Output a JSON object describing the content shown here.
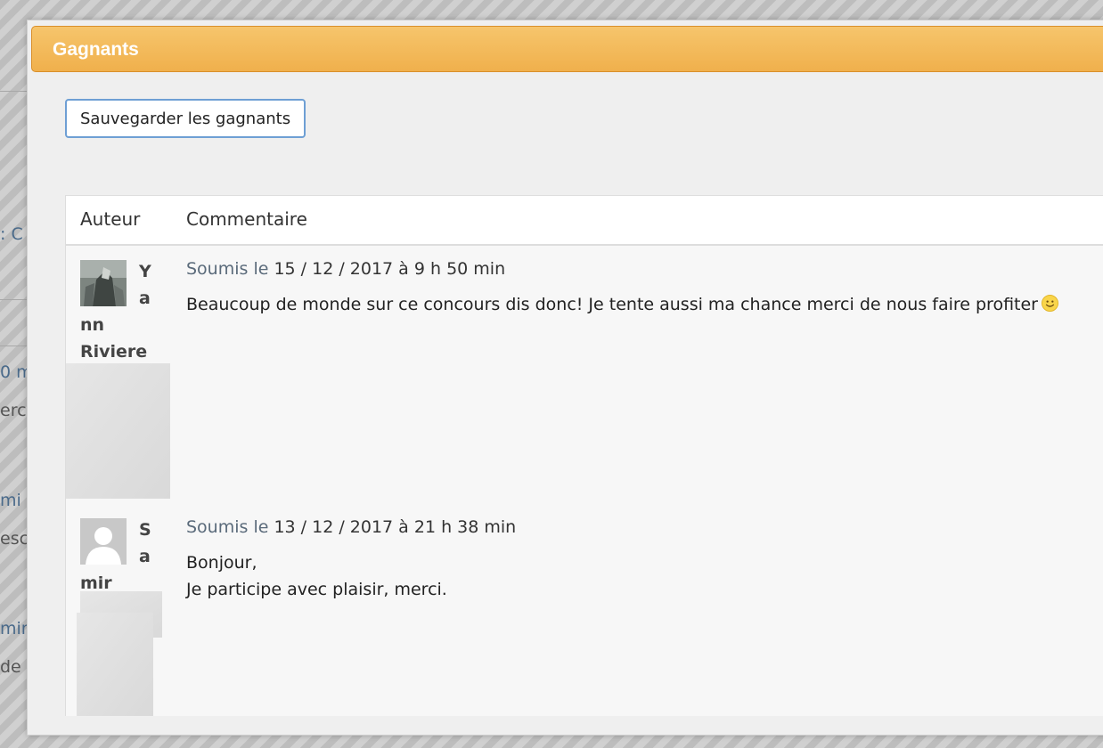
{
  "background": {
    "fragments": [
      ":  C",
      "0  m",
      "erc",
      "mi",
      "esc",
      "min",
      "de  r"
    ]
  },
  "modal": {
    "title": "Gagnants",
    "save_button": "Sauvegarder les gagnants",
    "table": {
      "headers": [
        "Auteur",
        "Commentaire"
      ],
      "rows": [
        {
          "author_lines": [
            "Y",
            "a",
            "nn",
            "Riviere"
          ],
          "meta_label": "Soumis le",
          "meta_date": "15 / 12 / 2017 à 9 h 50 min",
          "comment_lines": [
            "Beaucoup de monde sur ce concours dis donc! Je tente aussi ma chance merci de nous faire profiter"
          ],
          "has_smiley": true,
          "avatar": "user-photo"
        },
        {
          "author_lines": [
            "S",
            "a",
            "mir"
          ],
          "meta_label": "Soumis le",
          "meta_date": "13 / 12 / 2017 à 21 h 38 min",
          "comment_lines": [
            "Bonjour,",
            "Je participe avec plaisir, merci."
          ],
          "has_smiley": false,
          "avatar": "default-avatar-icon"
        }
      ]
    }
  },
  "icons": {
    "smiley": "smiley-icon",
    "default_avatar": "default-avatar-icon"
  },
  "colors": {
    "header_orange": "#f0b04c",
    "button_border": "#6e9fd4"
  }
}
